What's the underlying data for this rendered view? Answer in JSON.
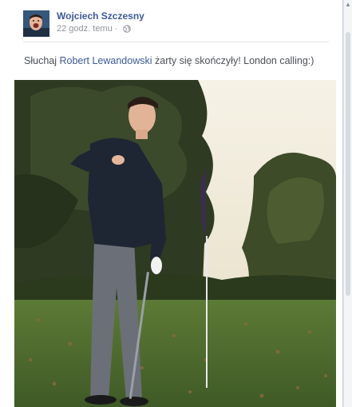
{
  "post": {
    "author": "Wojciech Szczesny",
    "timestamp": "22 godz. temu",
    "separator": "·",
    "audience_icon": "globe-icon",
    "text_before": "Słuchaj ",
    "mention": "Robert Lewandowski",
    "text_after": " żarty się skończyły! London calling:)"
  },
  "colors": {
    "link": "#3b5998",
    "meta": "#90949c",
    "text": "#4b4f56"
  }
}
